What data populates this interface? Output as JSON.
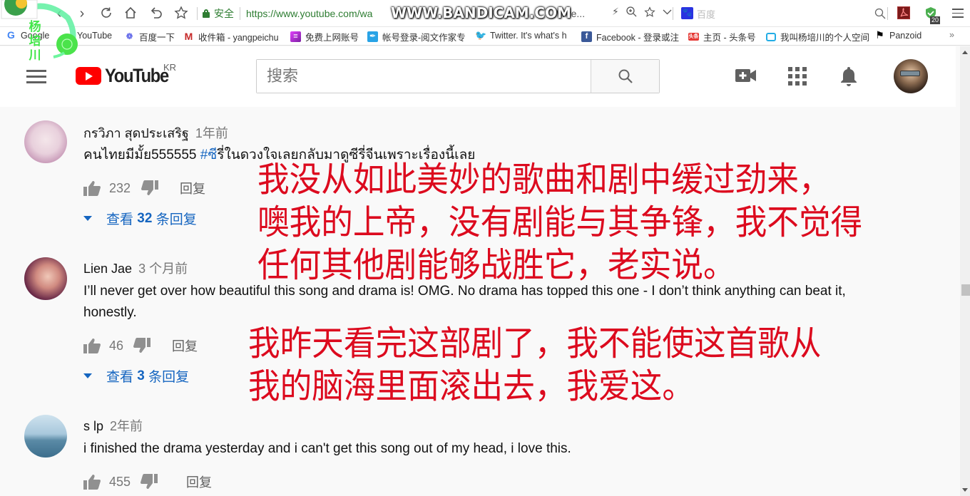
{
  "browser": {
    "secure_label": "安全",
    "url": "https://www.youtube.com/watch?v=...Wve...",
    "url_visible_start": "https://www.youtube.com/wa",
    "url_visible_end": "Wve...",
    "watermark": "WWW.BANDICAM.COM",
    "search_engine_placeholder": "百度",
    "extension_badge": "20",
    "bookmarks": [
      {
        "label": "Google",
        "icon": "google-icon"
      },
      {
        "label": "YouTube",
        "icon": "youtube-icon"
      },
      {
        "label": "百度一下",
        "icon": "baidu-icon"
      },
      {
        "label": "收件箱 - yangpeichu",
        "icon": "gmail-icon"
      },
      {
        "label": "免费上网账号",
        "icon": "bookmark-icon"
      },
      {
        "label": "帐号登录-阅文作家专",
        "icon": "yuewen-icon"
      },
      {
        "label": "Twitter. It's what's h",
        "icon": "twitter-icon"
      },
      {
        "label": "Facebook - 登录或注",
        "icon": "facebook-icon"
      },
      {
        "label": "主页 - 头条号",
        "icon": "toutiao-icon"
      },
      {
        "label": "我叫杨培川的个人空间",
        "icon": "bilibili-icon"
      },
      {
        "label": "Panzoid",
        "icon": "panzoid-icon"
      }
    ],
    "more_bookmarks": "»"
  },
  "watermark_logo": {
    "name_chars": [
      "杨",
      "培",
      "川"
    ]
  },
  "youtube": {
    "logo_text": "YouTube",
    "region": "KR",
    "search_placeholder": "搜索",
    "colors": {
      "brand_red": "#ff0000",
      "link_blue": "#1565c0",
      "overlay_red": "#dc0a1e"
    }
  },
  "comments": [
    {
      "author": "กรวิภา สุดประเสริฐ",
      "time": "1年前",
      "text_before_hashtag": "คนไทยมีมั้ย555555 ",
      "hashtag": "#ซี",
      "text_after_hashtag": "รี่ในดวงใจเลยกลับมาดูซีรี่จีนเพราะเรื่องนี้เลย",
      "likes": "232",
      "reply_label": "回复",
      "replies_prefix": "查看",
      "replies_count": "32",
      "replies_suffix": "条回复"
    },
    {
      "author": "Lien Jae",
      "time": "3 个月前",
      "text": "I’ll never get over how beautiful this song and drama is! OMG. No drama has topped this one - I don’t think anything can beat it, honestly.",
      "likes": "46",
      "reply_label": "回复",
      "replies_prefix": "查看",
      "replies_count": "3",
      "replies_suffix": "条回复"
    },
    {
      "author": "s lp",
      "time": "2年前",
      "text": "i finished the drama yesterday and i can't get this song out of my head, i love this.",
      "likes": "455",
      "reply_label": "回复"
    }
  ],
  "translations": [
    {
      "lines": [
        "我没从如此美妙的歌曲和剧中缓过劲来，",
        "噢我的上帝，没有剧能与其争锋，我不觉得",
        "任何其他剧能够战胜它，老实说。"
      ]
    },
    {
      "lines": [
        "我昨天看完这部剧了，我不能使这首歌从",
        "我的脑海里面滚出去，我爱这。"
      ]
    }
  ]
}
